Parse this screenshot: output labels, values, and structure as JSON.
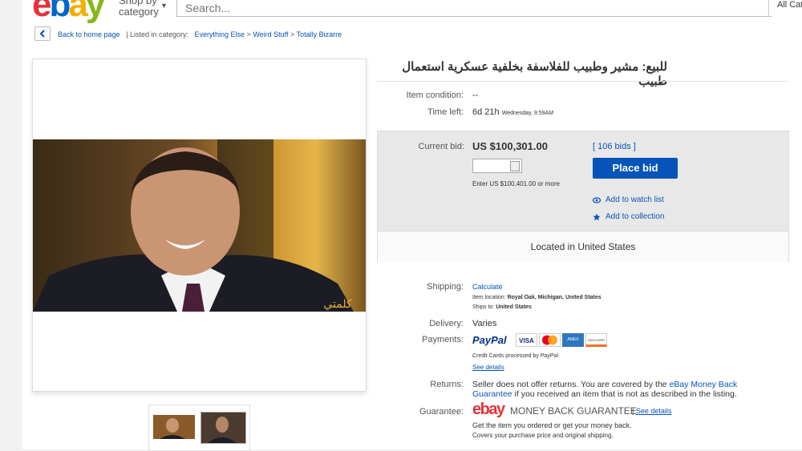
{
  "header": {
    "logo_letters": [
      "e",
      "b",
      "a",
      "y"
    ],
    "logo_colors": [
      "#e53238",
      "#0064d2",
      "#f5af02",
      "#86b817"
    ],
    "shop_by": "Shop by",
    "category": "category",
    "search_placeholder": "Search...",
    "all_categories": "All Cat"
  },
  "breadcrumb": {
    "back": "Back to home page",
    "separator": "|",
    "listed": "Listed in category:",
    "items": [
      "Everything Else",
      "Weird Stuff",
      "Totally Bizarre"
    ],
    "arrow": ">"
  },
  "photo": {
    "watermark": "كلمتي"
  },
  "listing": {
    "title": "للبيع: مشير وطبيب للفلاسفة بخلفية عسكرية استعمال طبيب",
    "condition_label": "Item condition:",
    "condition_value": "--",
    "time_label": "Time left:",
    "time_value": "6d 21h",
    "time_detail": "Wednesday, 9:59AM"
  },
  "bid": {
    "current_label": "Current bid:",
    "current_value": "US $100,301.00",
    "bids": "[ 106 bids ]",
    "enter_hint": "Enter US $100,401.00 or more",
    "place_bid": "Place bid",
    "watch_list": "Add to watch list",
    "collection": "Add to collection",
    "located": "Located in United States"
  },
  "shipping": {
    "label": "Shipping:",
    "value": "Calculate",
    "loc_label": "Item location:",
    "loc_value": "Royal Oak, Michigan, United States",
    "ships_label": "Ships to:",
    "ships_value": "United States"
  },
  "delivery": {
    "label": "Delivery:",
    "value": "Varies"
  },
  "payments": {
    "label": "Payments:",
    "paypal": "PayPal",
    "visa": "VISA",
    "amex": "AMEX",
    "discover": "DISCOVER",
    "processed": "Credit Cards processed by PayPal",
    "see_details": "See details"
  },
  "returns": {
    "label": "Returns:",
    "text1": "Seller does not offer returns. You are covered by the",
    "link1": "eBay Money Back",
    "link2": "Guarantee",
    "text2": "if you received an item that is not as described in the listing."
  },
  "guarantee": {
    "label": "Guarantee:",
    "logo_text": "ebay",
    "mbg": "MONEY BACK GUARANTEE",
    "see_details": "See details",
    "line1": "Get the item you ordered or get your money back.",
    "line2": "Covers your purchase price and original shipping."
  },
  "colors": {
    "link": "#0654ba",
    "button": "#0654ba",
    "bidbox": "#e8e8e8"
  }
}
